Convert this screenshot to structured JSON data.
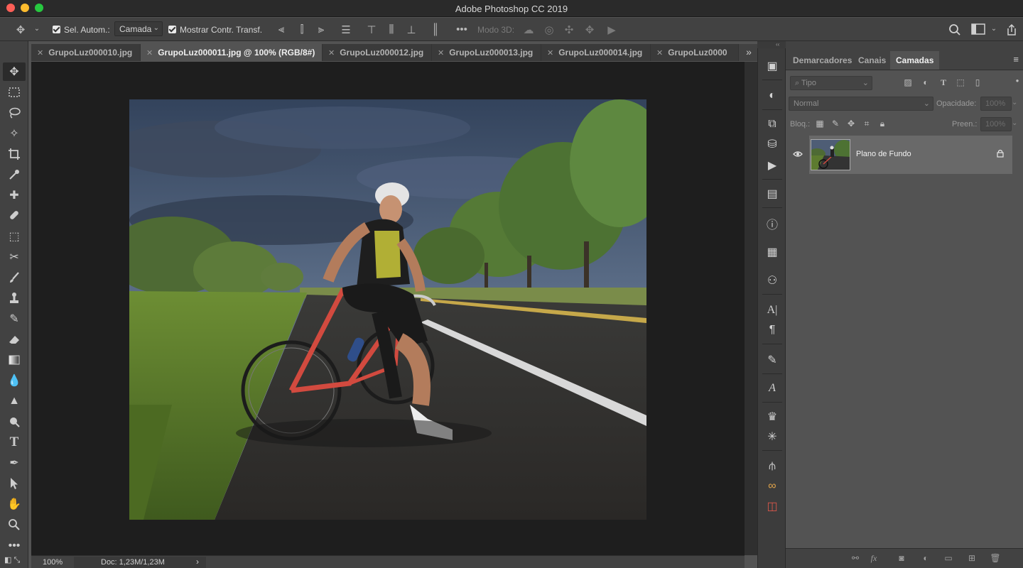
{
  "window": {
    "title": "Adobe Photoshop CC 2019"
  },
  "options_bar": {
    "move_tool_icon": "move-icon",
    "auto_select_label": "Sel. Autom.:",
    "auto_select_checked": true,
    "auto_select_target": "Camada",
    "show_transform_label": "Mostrar Contr. Transf.",
    "show_transform_checked": true,
    "mode_3d_label": "Modo 3D:"
  },
  "tabs": [
    {
      "label": "GrupoLuz000010.jpg",
      "active": false
    },
    {
      "label": "GrupoLuz000011.jpg @ 100% (RGB/8#)",
      "active": true
    },
    {
      "label": "GrupoLuz000012.jpg",
      "active": false
    },
    {
      "label": "GrupoLuz000013.jpg",
      "active": false
    },
    {
      "label": "GrupoLuz000014.jpg",
      "active": false
    },
    {
      "label": "GrupoLuz0000",
      "active": false
    }
  ],
  "status": {
    "zoom": "100%",
    "doc": "Doc: 1,23M/1,23M"
  },
  "panels": {
    "tabs": [
      "Demarcadores",
      "Canais",
      "Camadas"
    ],
    "active_tab": "Camadas",
    "filter_kind": "Tipo",
    "blend_mode": "Normal",
    "opacity_label": "Opacidade:",
    "opacity_value": "100%",
    "lock_label": "Bloq.:",
    "fill_label": "Preen.:",
    "fill_value": "100%",
    "layers": [
      {
        "name": "Plano de Fundo",
        "visible": true,
        "locked": true
      }
    ]
  },
  "colors": {
    "window_bg": "#535353",
    "canvas_bg": "#1e1e1e",
    "panel_bg": "#424242",
    "selected_layer": "#696969"
  }
}
